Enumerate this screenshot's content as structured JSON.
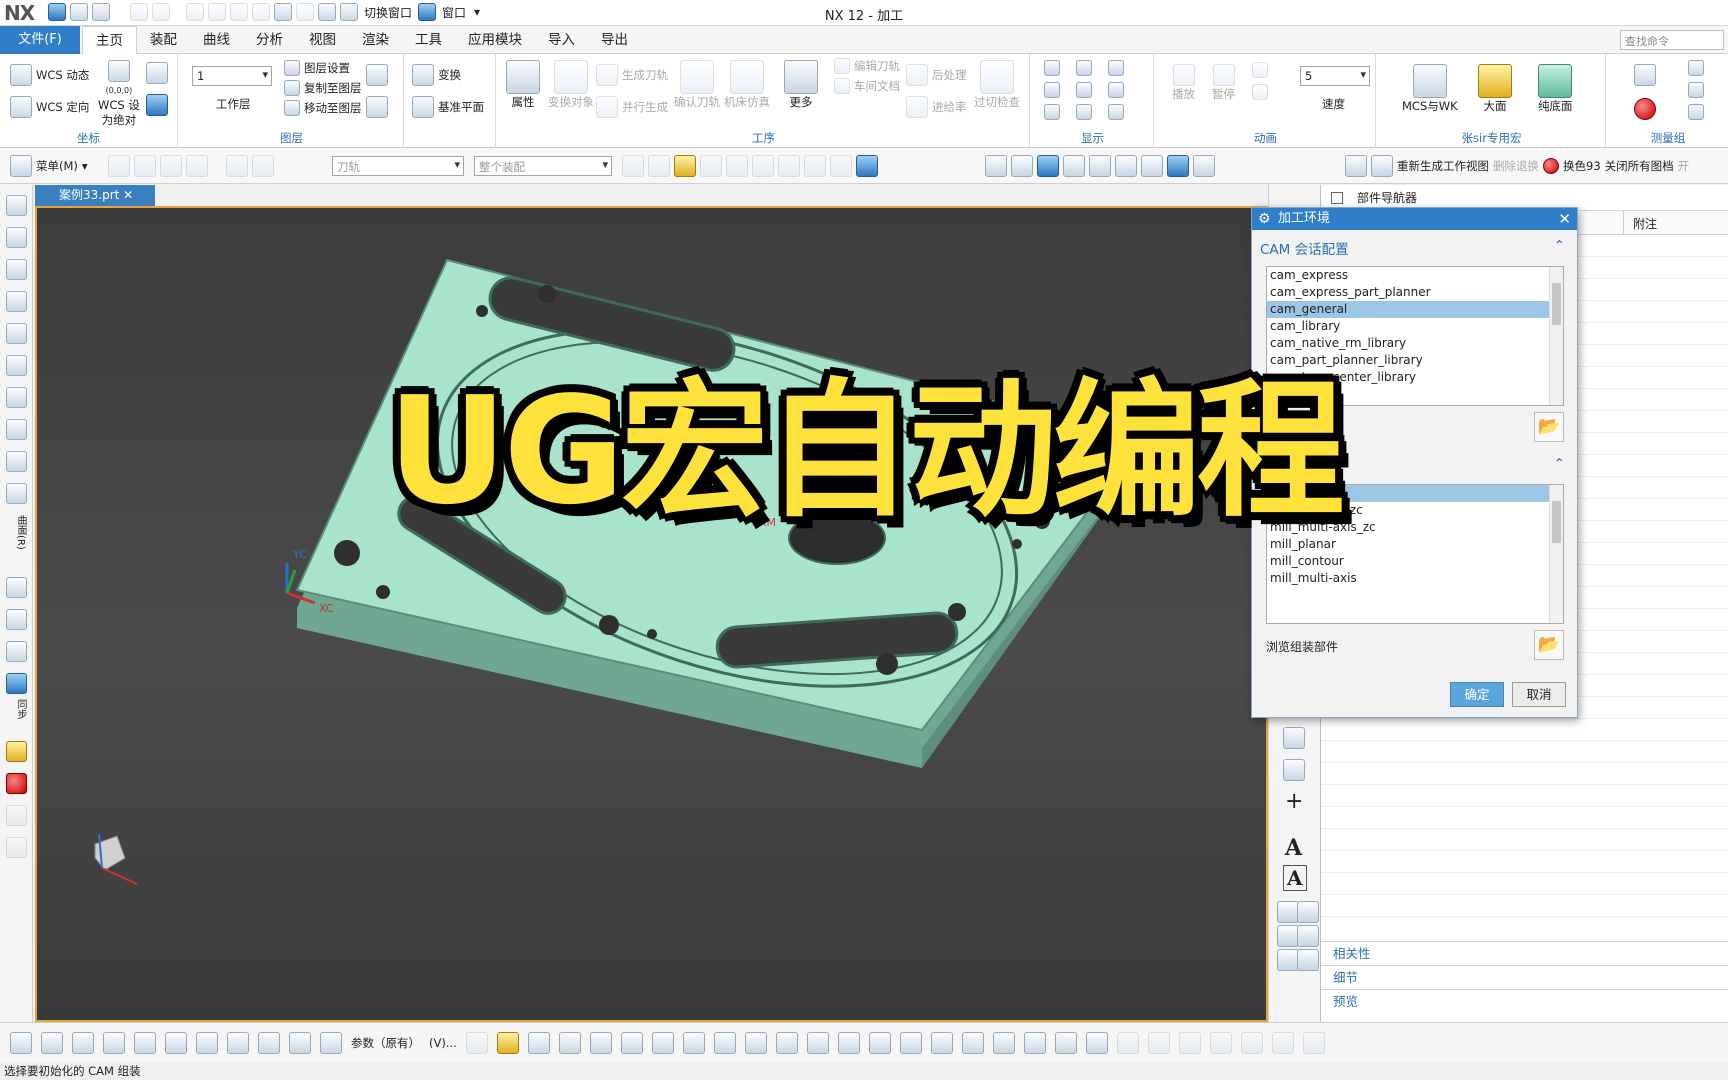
{
  "app": {
    "logo": "NX",
    "window_title": "NX 12 - 加工",
    "switch_window": "切换窗口",
    "window_menu": "窗口"
  },
  "menubar": {
    "file": "文件(F)",
    "tabs": [
      "主页",
      "装配",
      "曲线",
      "分析",
      "视图",
      "渲染",
      "工具",
      "应用模块",
      "导入",
      "导出"
    ],
    "active_tab": "主页",
    "search_placeholder": "查找命令"
  },
  "ribbon": {
    "coords": {
      "label": "坐标",
      "wcs_dynamic": "WCS 动态",
      "wcs_orient": "WCS 定向",
      "wcs_set_abs_1": "WCS 设",
      "wcs_set_abs_2": "为绝对",
      "origin_label": "(0,0,0)"
    },
    "layers": {
      "label": "图层",
      "work_layer_value": "1",
      "work_layer": "工作层",
      "layer_settings": "图层设置",
      "copy_to_layer": "复制至图层",
      "move_to_layer": "移动至图层"
    },
    "transform": {
      "transform": "变换",
      "datum_plane": "基准平面"
    },
    "operations": {
      "label": "工序",
      "properties": "属性",
      "transform_obj": "变换对象",
      "generate_path": "生成刀轨",
      "parallel_generate": "并行生成",
      "confirm_path": "确认刀轨",
      "machine_sim": "机床仿真",
      "more": "更多",
      "edit_path": "编辑刀轨",
      "shop_doc": "车间文档",
      "post_process": "后处理",
      "feed_rate": "进给率",
      "check_process": "过切检查"
    },
    "display": {
      "label": "显示"
    },
    "animation": {
      "label": "动画",
      "play": "播放",
      "pause": "暂停",
      "speed_value": "5",
      "speed": "速度"
    },
    "macros": {
      "label": "张sir专用宏",
      "mcs_wk": "MCS与WK",
      "big_face": "大面",
      "pure_face": "纯底面"
    },
    "measure": {
      "label": "测量组"
    }
  },
  "toolbar2": {
    "menu": "菜单(M)",
    "selection_filter": "刀轨",
    "assembly_filter": "整个装配",
    "regen_view": "重新生成工作视图",
    "delete_regen": "删除退换",
    "color_swap": "换色93",
    "close_all": "关闭所有图档",
    "open": "开"
  },
  "viewport": {
    "tab_label": "案例33.prt",
    "axis_yc": "YC",
    "axis_xc": "XC",
    "mcs_label": "XM"
  },
  "left_bar": {
    "label_1": "曲面(R)",
    "label_2": "同步"
  },
  "navigator": {
    "title": "部件导航器",
    "col_notes": "附注",
    "sections": [
      "相关性",
      "细节",
      "预览"
    ]
  },
  "dialog": {
    "title": "加工环境",
    "section_cam": "CAM 会话配置",
    "cam_configs": [
      "cam_express",
      "cam_express_part_planner",
      "cam_general",
      "cam_library",
      "cam_native_rm_library",
      "cam_part_planner_library",
      "cam_teamcenter_library"
    ],
    "selected_config": "cam_general",
    "setups_to_create": [
      "mill_planar",
      "mill_contour_zc",
      "mill_multi-axis_zc",
      "mill_planar",
      "mill_contour",
      "mill_multi-axis"
    ],
    "browse_assembly": "浏览组装部件",
    "ok": "确定",
    "cancel": "取消"
  },
  "bottom_bar": {
    "param": "参数（原有）",
    "view": "(V)..."
  },
  "status": "选择要初始化的 CAM 组装",
  "overlay": {
    "title": "UG宏自动编程"
  },
  "colors": {
    "accent": "#2f80c8",
    "part": "#a8e3cc",
    "overlay_text": "#ffe23b"
  }
}
